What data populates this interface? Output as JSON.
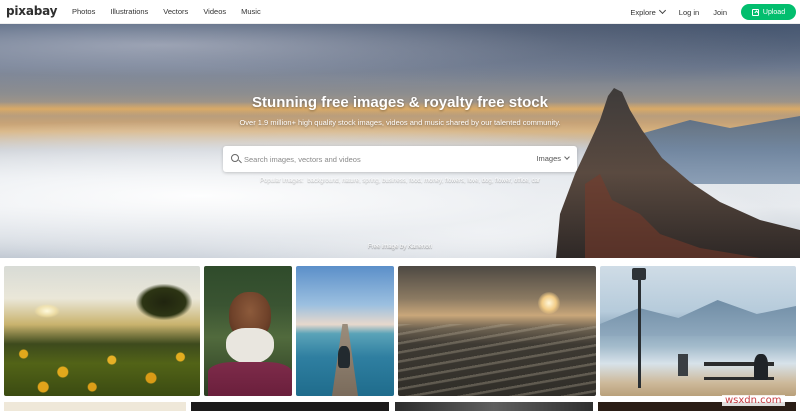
{
  "header": {
    "logo": "pixabay",
    "nav": [
      "Photos",
      "Illustrations",
      "Vectors",
      "Videos",
      "Music"
    ],
    "explore_label": "Explore",
    "login_label": "Log in",
    "join_label": "Join",
    "upload_label": "Upload"
  },
  "hero": {
    "title": "Stunning free images & royalty free stock",
    "subtitle": "Over 1.9 million+ high quality stock images, videos and music shared by our talented community.",
    "search_placeholder": "Search images, vectors and videos",
    "search_type": "Images",
    "popular_label": "Popular Images:",
    "popular_terms": "background, nature, spring, business, food, money, flowers, love, dog, flower, office, car",
    "credit": "Free image by Kanenori"
  },
  "gallery": {
    "tiles": [
      "sunflower-field",
      "elderly-man-portrait",
      "pier-ocean",
      "marsh-sunset",
      "lamp-bench-lake"
    ]
  },
  "watermark": "wsxdn.com",
  "colors": {
    "upload_button": "#02be6e",
    "watermark": "#c63c42"
  }
}
